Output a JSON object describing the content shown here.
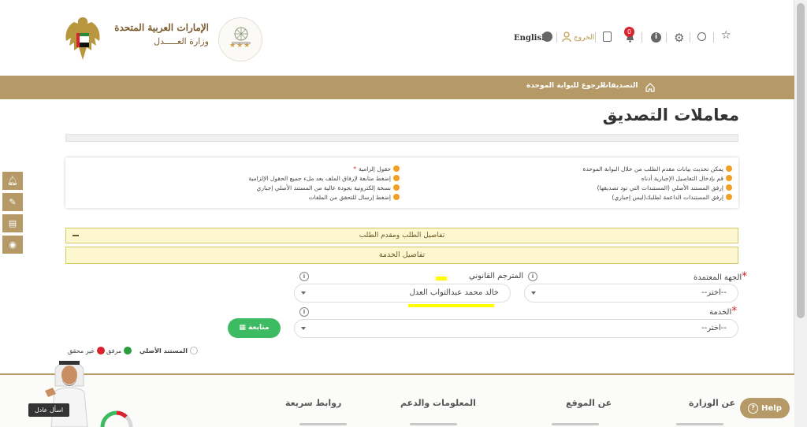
{
  "header": {
    "logo_line1": "الإمارات العربية المتحدة",
    "logo_line2": "وزارة العـــــدل",
    "language": "English",
    "logout": "الخروج",
    "notification_count": "0"
  },
  "nav": {
    "items": [
      "التصديقات",
      "الرجوع للبوابة الموحدة"
    ]
  },
  "page": {
    "title": "معاملات التصديق"
  },
  "notes": {
    "right": [
      "يمكن تحديث بيانات مقدم الطلب من خلال البوابة الموحدة",
      "قم بإدخال التفاصيل الإجبارية أدناه",
      "إرفق المستند الأصلي (المستندات التي تود تصديقها)",
      "إرفق المستندات الداعمة لطلبك(ليس إجباري)"
    ],
    "left": [
      "حقول إلزامية",
      "إضغط متابعة لإرفاق الملف بعد ملء جميع الحقول الإلزامية",
      "نسخة إلكترونية بجودة عالية من المستند الأصلي إجباري",
      "إضغط إرسال للتحقق من الملفات"
    ],
    "required_mark": "*"
  },
  "sections": {
    "applicant": "تفاصيل الطلب ومقدم الطلب",
    "service": "تفاصيل الخدمة"
  },
  "form": {
    "authority_label": "الجهة المعتمدة",
    "authority_value": "--اختر--",
    "translator_label": "المترجم القانوني",
    "translator_value": "خالد محمد عبدالتواب العدل",
    "service_label": "الخدمة",
    "service_value": "--اختر--",
    "required_mark": "*",
    "info_mark": "i",
    "next_button": "متابعة"
  },
  "legend": {
    "original": "المستند الأصلي",
    "attached": "مرفق",
    "not_verified": "غير محقق"
  },
  "footer": {
    "columns": [
      "عن الوزارة",
      "عن الموقع",
      "المعلومات والدعم",
      "روابط سريعة"
    ],
    "help": "Help",
    "ask": "اسأل عادل"
  },
  "colors": {
    "gold": "#b59a68",
    "accordion_bg": "#fcf7cf",
    "green": "#3dbb62",
    "red": "#d9232d",
    "highlight": "#ffff00"
  }
}
